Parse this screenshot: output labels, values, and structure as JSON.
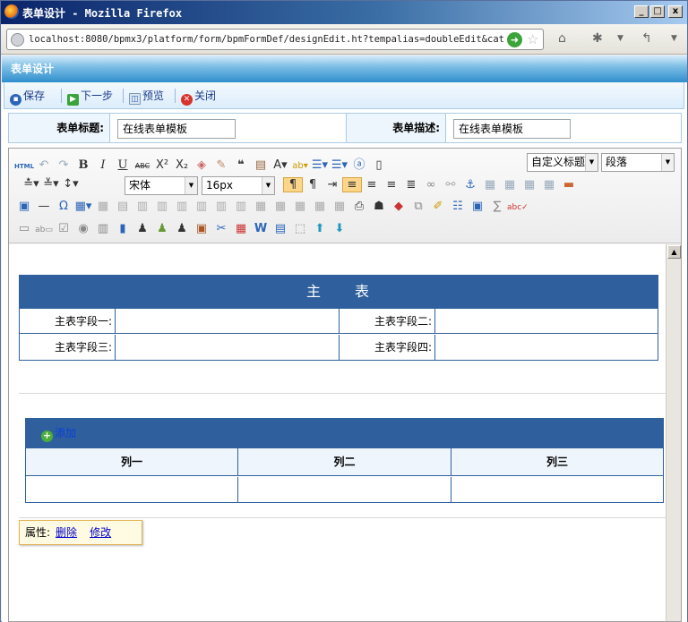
{
  "window": {
    "title": "表单设计 - Mozilla Firefox",
    "min": "_",
    "max": "□",
    "close": "x"
  },
  "browser": {
    "url": "localhost:8080/bpmx3/platform/form/bpmFormDef/designEdit.ht?tempalias=doubleEdit&cat"
  },
  "page": {
    "title": "表单设计"
  },
  "toolbar": {
    "save": "保存",
    "next": "下一步",
    "preview": "预览",
    "close": "关闭"
  },
  "form": {
    "title_label": "表单标题:",
    "title_value": "在线表单模板",
    "desc_label": "表单描述:",
    "desc_value": "在线表单模板"
  },
  "editor": {
    "html_label": "HTML",
    "heading_select": "自定义标题",
    "paragraph_select": "段落",
    "font_select": "宋体",
    "size_select": "16px"
  },
  "main_table": {
    "header": "主　　表",
    "fields": [
      "主表字段一:",
      "主表字段二:",
      "主表字段三:",
      "主表字段四:"
    ]
  },
  "sub_table": {
    "add_label": "添加",
    "columns": [
      "列一",
      "列二",
      "列三"
    ]
  },
  "props": {
    "label": "属性:",
    "delete": "删除",
    "modify": "修改"
  },
  "colors": {
    "table_header": "#2f609d",
    "page_title": "#2f8fcc"
  }
}
